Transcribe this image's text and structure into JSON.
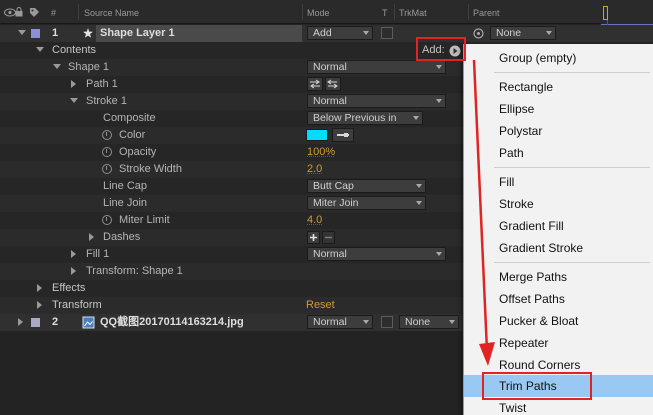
{
  "columns": {
    "number": "#",
    "source_name": "Source Name",
    "mode": "Mode",
    "t": "T",
    "trkmat": "TrkMat",
    "parent": "Parent"
  },
  "layer1": {
    "number": "1",
    "name": "Shape Layer 1",
    "mode": "Add",
    "parent": "None"
  },
  "contents": {
    "label": "Contents",
    "add_label": "Add:"
  },
  "shape1": {
    "label": "Shape 1",
    "mode": "Normal"
  },
  "path1": {
    "label": "Path 1"
  },
  "stroke1": {
    "label": "Stroke 1",
    "mode": "Normal",
    "composite_label": "Composite",
    "composite_value": "Below Previous in",
    "color_label": "Color",
    "color_value": "#00dcff",
    "opacity_label": "Opacity",
    "opacity_value": "100%",
    "width_label": "Stroke Width",
    "width_value": "2.0",
    "linecap_label": "Line Cap",
    "linecap_value": "Butt Cap",
    "linejoin_label": "Line Join",
    "linejoin_value": "Miter Join",
    "miter_label": "Miter Limit",
    "miter_value": "4.0",
    "dashes_label": "Dashes"
  },
  "fill1": {
    "label": "Fill 1",
    "mode": "Normal"
  },
  "transform_shape": {
    "label": "Transform: Shape 1"
  },
  "effects": {
    "label": "Effects"
  },
  "transform": {
    "label": "Transform",
    "reset_label": "Reset"
  },
  "layer2": {
    "number": "2",
    "name": "QQ截图20170114163214.jpg",
    "mode": "Normal",
    "parent": "None"
  },
  "menu": {
    "items": [
      "Group (empty)",
      "Rectangle",
      "Ellipse",
      "Polystar",
      "Path",
      "Fill",
      "Stroke",
      "Gradient Fill",
      "Gradient Stroke",
      "Merge Paths",
      "Offset Paths",
      "Pucker & Bloat",
      "Repeater",
      "Round Corners",
      "Trim Paths",
      "Twist"
    ],
    "selected": "Trim Paths"
  },
  "colors": {
    "annotation_red": "#e02323",
    "selection_blue": "#99c9f2",
    "value_orange": "#d39b2f",
    "stroke_color": "#00dcff"
  },
  "icons": [
    "eye-icon",
    "lock-icon",
    "label-color-icon",
    "star-icon",
    "stopwatch-icon",
    "image-file-icon",
    "add-arrow-icon",
    "pickwhip-icon"
  ]
}
